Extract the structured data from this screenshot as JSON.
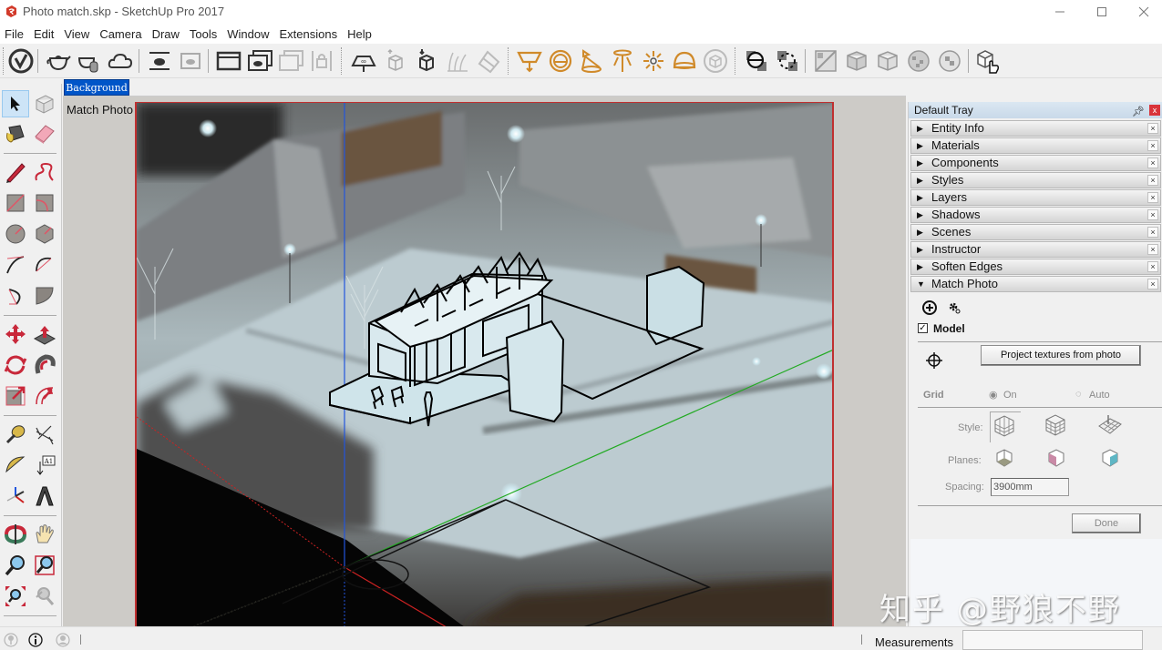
{
  "window": {
    "title": "Photo match.skp - SketchUp Pro 2017",
    "controls": [
      "minimize",
      "maximize",
      "close"
    ]
  },
  "menu": {
    "items": [
      "File",
      "Edit",
      "View",
      "Camera",
      "Draw",
      "Tools",
      "Window",
      "Extensions",
      "Help"
    ]
  },
  "toolbar": {
    "groups": [
      [
        "v-ray-logo-icon"
      ],
      [
        "teapot-render-icon",
        "teapot-interactive-icon",
        "cloud-render-icon"
      ],
      [
        "frame-buffer-icon",
        "last-frame-icon"
      ],
      [
        "window-icon",
        "teapot-window-icon",
        "cloud-window-icon",
        "lock-icon"
      ],
      [
        "infinite-plane-icon",
        "export-proxy-icon",
        "import-proxy-icon",
        "fur-icon",
        "mesh-clipper-icon"
      ],
      [
        "rect-light-icon",
        "sphere-light-icon",
        "spot-light-icon",
        "ies-light-icon",
        "omni-light-icon",
        "dome-light-icon",
        "mesh-light-icon"
      ],
      [
        "cast-shadows-icon",
        "dashed-sphere-icon"
      ],
      [
        "uv-texture-icon",
        "cube-map-icon",
        "box-map-icon",
        "sphere-map-icon",
        "cylinder-map-icon"
      ],
      [
        "select-hand-cube-icon"
      ]
    ]
  },
  "palette": {
    "tools": [
      "select-tool",
      "make-component-tool",
      "paint-bucket-tool",
      "eraser-tool",
      "line-tool",
      "freehand-tool",
      "rectangle-tool",
      "rotated-rectangle-tool",
      "circle-tool",
      "polygon-tool",
      "arc-tool",
      "two-point-arc-tool",
      "three-point-arc-tool",
      "pie-tool",
      "move-tool",
      "push-pull-tool",
      "rotate-tool",
      "follow-me-tool",
      "scale-tool",
      "offset-tool",
      "tape-measure-tool",
      "dimension-tool",
      "protractor-tool",
      "text-tool",
      "axes-tool",
      "3d-text-tool",
      "orbit-tool",
      "pan-tool",
      "zoom-tool",
      "zoom-window-tool",
      "zoom-extents-tool",
      "previous-view-tool"
    ]
  },
  "viewport": {
    "scene_tab": "Background",
    "mode_label": "Match Photo"
  },
  "tray": {
    "title": "Default Tray",
    "panels": [
      {
        "label": "Entity Info",
        "expanded": false
      },
      {
        "label": "Materials",
        "expanded": false
      },
      {
        "label": "Components",
        "expanded": false
      },
      {
        "label": "Styles",
        "expanded": false
      },
      {
        "label": "Layers",
        "expanded": false
      },
      {
        "label": "Shadows",
        "expanded": false
      },
      {
        "label": "Scenes",
        "expanded": false
      },
      {
        "label": "Instructor",
        "expanded": false
      },
      {
        "label": "Soften Edges",
        "expanded": false
      },
      {
        "label": "Match Photo",
        "expanded": true
      }
    ],
    "match_photo": {
      "model_label": "Model",
      "model_checked": true,
      "project_button": "Project textures from photo",
      "grid_label": "Grid",
      "grid_on": "On",
      "grid_auto": "Auto",
      "grid_selected": "On",
      "style_label": "Style:",
      "planes_label": "Planes:",
      "spacing_label": "Spacing:",
      "spacing_value": "3900mm",
      "done_button": "Done"
    }
  },
  "status": {
    "measurements_label": "Measurements",
    "measurements_value": ""
  },
  "watermark": "知乎 @野狼不野",
  "colors": {
    "scene_tab_bg": "#0055c8",
    "photo_frame": "#c03030",
    "axis_red": "#cc2222",
    "axis_green": "#22aa22",
    "axis_blue": "#2255dd",
    "vray_orange": "#d08a2a"
  }
}
